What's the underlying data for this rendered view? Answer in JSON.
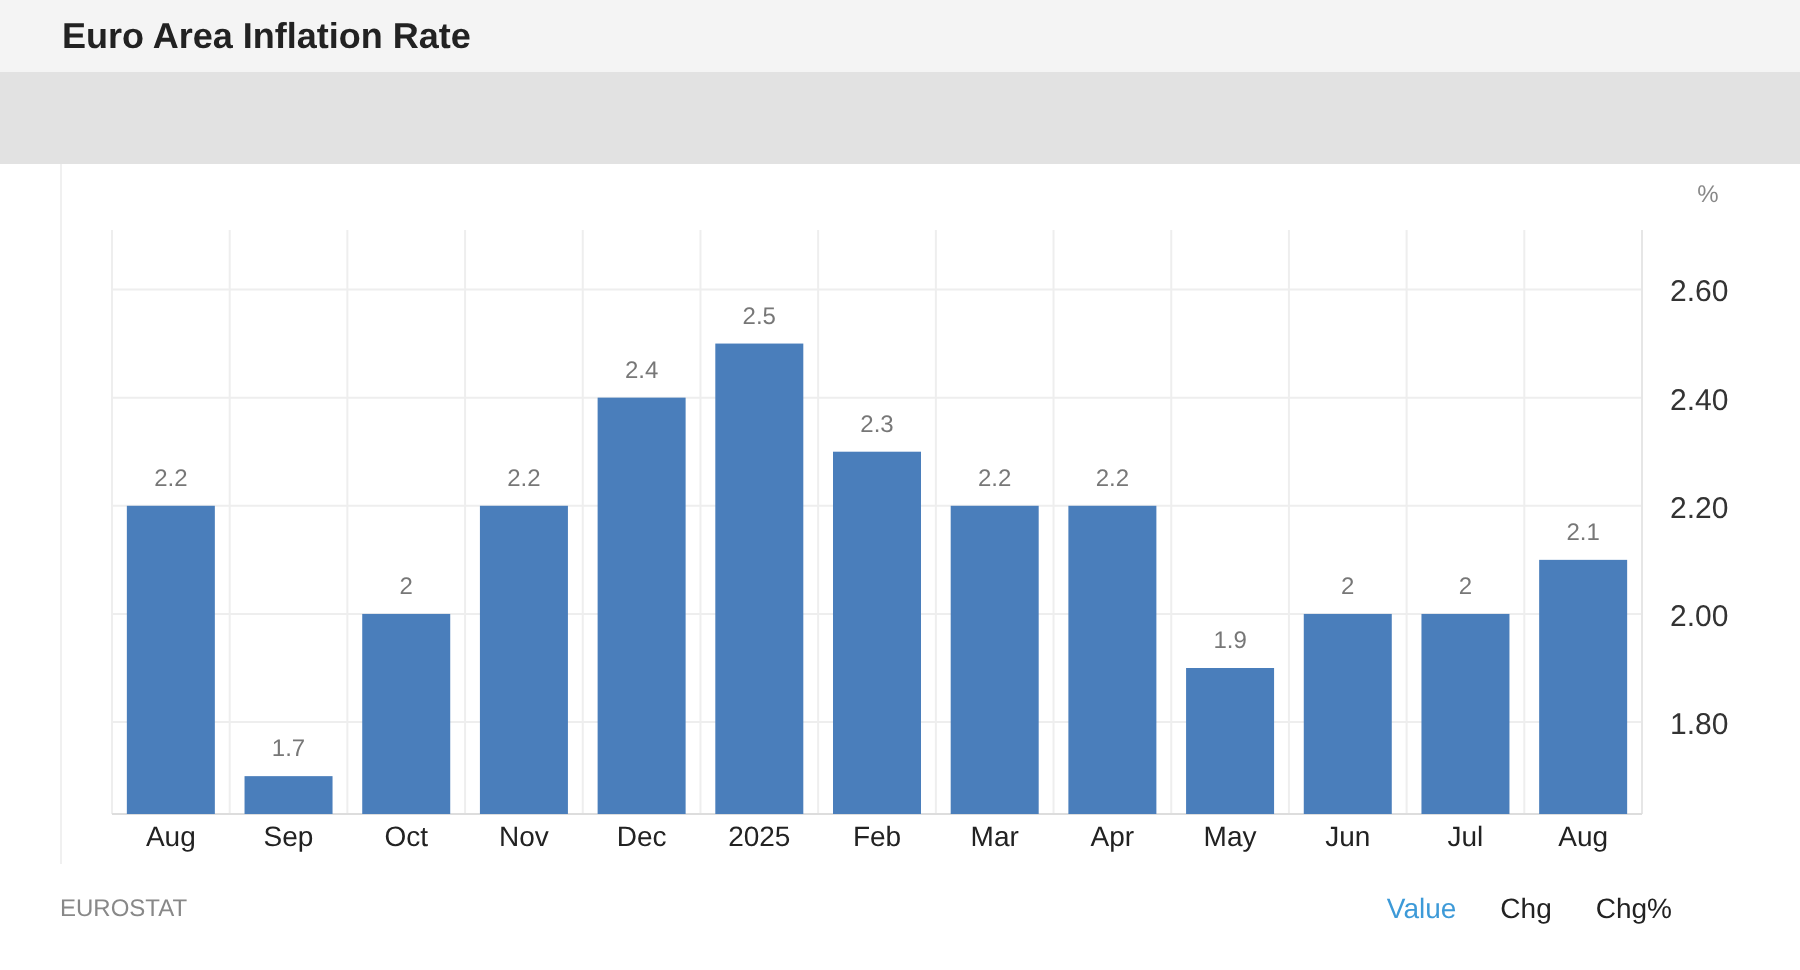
{
  "title": "Euro Area Inflation Rate",
  "chart": {
    "unit": "%",
    "chart_data": {
      "type": "bar",
      "categories": [
        "Aug",
        "Sep",
        "Oct",
        "Nov",
        "Dec",
        "2025",
        "Feb",
        "Mar",
        "Apr",
        "May",
        "Jun",
        "Jul",
        "Aug"
      ],
      "grid": true,
      "series": [
        {
          "color": "#4a7ebb",
          "values": [
            2.2,
            1.7,
            2.0,
            2.2,
            2.4,
            2.5,
            2.3,
            2.2,
            2.2,
            1.9,
            2.0,
            2.0,
            2.1
          ]
        }
      ],
      "value_labels": [
        "2.2",
        "1.7",
        "2",
        "2.2",
        "2.4",
        "2.5",
        "2.3",
        "2.2",
        "2.2",
        "1.9",
        "2",
        "2",
        "2.1"
      ],
      "ylim": [
        1.63,
        2.71
      ],
      "yticks": [
        {
          "value": 1.8,
          "label": "1.80"
        },
        {
          "value": 2.0,
          "label": "2.00"
        },
        {
          "value": 2.2,
          "label": "2.20"
        },
        {
          "value": 2.4,
          "label": "2.40"
        },
        {
          "value": 2.6,
          "label": "2.60"
        }
      ]
    }
  },
  "source": "EUROSTAT",
  "tabs": [
    {
      "label": "Value",
      "selected": true
    },
    {
      "label": "Chg",
      "selected": false
    },
    {
      "label": "Chg%",
      "selected": false
    }
  ]
}
